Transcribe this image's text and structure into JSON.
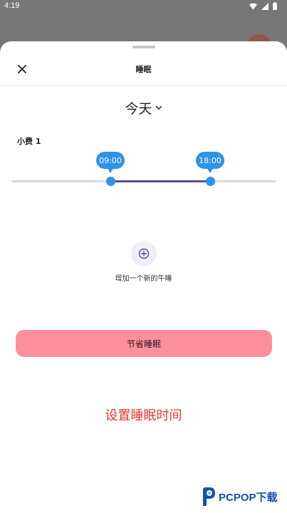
{
  "status_bar": {
    "time": "4:19",
    "icons": [
      "wifi-icon",
      "signal-icon",
      "battery-icon"
    ]
  },
  "sheet": {
    "title": "睡眠",
    "close_icon": "close-icon"
  },
  "date_selector": {
    "label": "今天",
    "icon": "chevron-down-icon"
  },
  "nap": {
    "label": "小费 1",
    "start_time": "09:00",
    "end_time": "18:00",
    "start_fraction": 0.375,
    "end_fraction": 0.75
  },
  "add_nap": {
    "label": "增加一个新的午睡",
    "icon": "plus-circle-icon"
  },
  "save_button": {
    "label": "节省睡眠"
  },
  "caption": {
    "text": "设置睡眠时间"
  },
  "logo": {
    "text": "PCPOP下载"
  },
  "colors": {
    "accent_blue": "#2f93e6",
    "range_purple": "#5d4c91",
    "button_pink": "#ff8f9c",
    "caption_red": "#e8382f",
    "logo_blue": "#1b4fa8"
  }
}
